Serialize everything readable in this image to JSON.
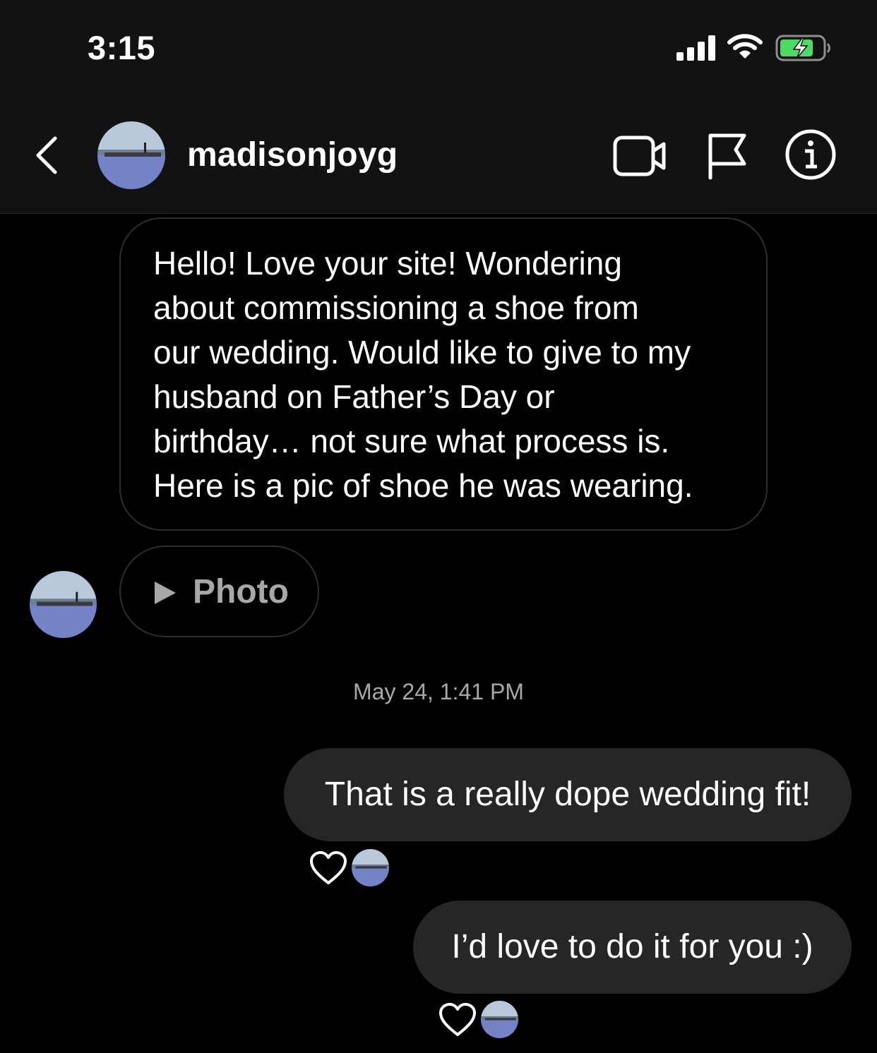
{
  "status_bar": {
    "time": "3:15",
    "icons": [
      "signal-icon",
      "wifi-icon",
      "battery-charging-icon"
    ],
    "battery_color": "#4cd964"
  },
  "header": {
    "username": "madisonjoyg",
    "icons": [
      "back-chevron-icon",
      "video-call-icon",
      "flag-icon",
      "info-icon"
    ]
  },
  "messages": {
    "incoming_text_lines": [
      "Hello! Love your site! Wondering",
      "about commissioning a shoe from",
      "our wedding. Would like to give to my",
      "husband on Father’s Day or",
      "birthday… not sure what process is.",
      "Here is a pic of shoe he was wearing."
    ],
    "photo_label": "Photo",
    "timestamp": "May 24, 1:41 PM",
    "outgoing": [
      {
        "text": "That is a really dope wedding fit!",
        "reaction": "heart"
      },
      {
        "text": "I’d love to do it for you :)",
        "reaction": "heart"
      }
    ]
  },
  "colors": {
    "background": "#000000",
    "header_bg": "#121212",
    "outgoing_bubble": "#262626",
    "incoming_border": "#2e2e2e",
    "muted_text": "#a8a8a8"
  }
}
